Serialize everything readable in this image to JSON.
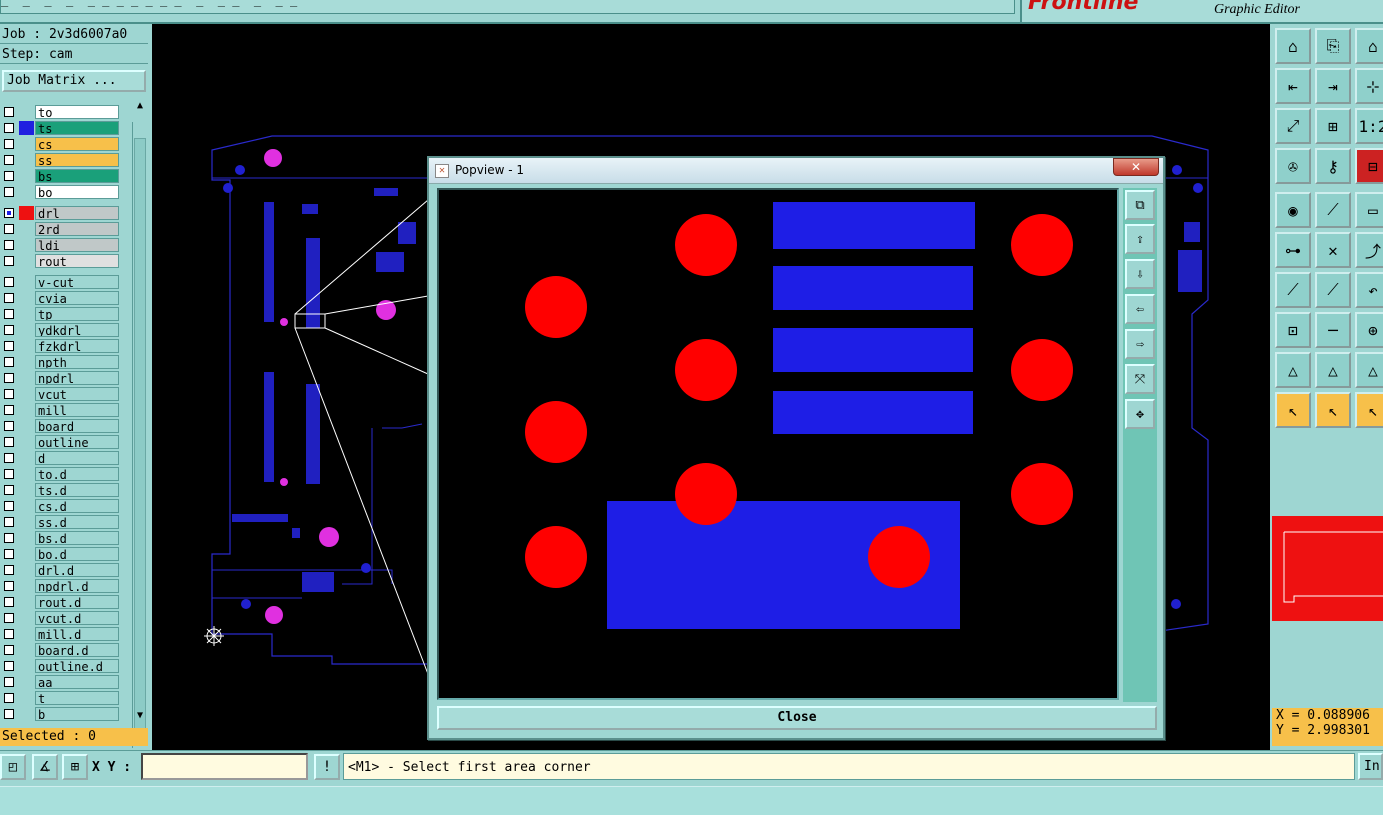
{
  "window": {
    "title_fragment": "_  _  _  _  _ _ _ _ _ _ _  _  _ _  _  _ _",
    "brand": "Frontline",
    "subtitle": "Graphic Editor"
  },
  "job": {
    "job_label": "Job : 2v3d6007a0",
    "step_label": "Step: cam",
    "matrix_button": "Job Matrix ..."
  },
  "layers": [
    {
      "name": "to",
      "swatch": "#ffffff",
      "bg": "#ffffff",
      "tag": "✎"
    },
    {
      "name": "ts",
      "swatch": "#2020e0",
      "bg": "#1aa07a",
      "tag": ""
    },
    {
      "name": "cs",
      "swatch": "#ffffff",
      "bg": "#f7c04a",
      "tag": "✎"
    },
    {
      "name": "ss",
      "swatch": "#ffffff",
      "bg": "#f7c04a",
      "tag": ""
    },
    {
      "name": "bs",
      "swatch": "#ffffff",
      "bg": "#1aa07a",
      "tag": ""
    },
    {
      "name": "bo",
      "swatch": "#ffffff",
      "bg": "#ffffff",
      "tag": ""
    },
    {
      "name": "drl",
      "swatch": "#ee1111",
      "bg": "#c0c8c8",
      "tag": "▦"
    },
    {
      "name": "2rd",
      "swatch": "#ffffff",
      "bg": "#c0c8c8",
      "tag": ""
    },
    {
      "name": "ldi",
      "swatch": "#ffffff",
      "bg": "#c0c8c8",
      "tag": ""
    },
    {
      "name": "rout",
      "swatch": "#ffffff",
      "bg": "#e0e0e0",
      "tag": ""
    },
    {
      "name": "v-cut",
      "swatch": "#ffffff",
      "bg": "#9ed6d2",
      "tag": ""
    },
    {
      "name": "cvia",
      "swatch": "#ffffff",
      "bg": "#9ed6d2",
      "tag": ""
    },
    {
      "name": "tp",
      "swatch": "#ffffff",
      "bg": "#9ed6d2",
      "tag": ""
    },
    {
      "name": "ydkdrl",
      "swatch": "#ffffff",
      "bg": "#9ed6d2",
      "tag": ""
    },
    {
      "name": "fzkdrl",
      "swatch": "#ffffff",
      "bg": "#9ed6d2",
      "tag": ""
    },
    {
      "name": "npth",
      "swatch": "#ffffff",
      "bg": "#9ed6d2",
      "tag": ""
    },
    {
      "name": "npdrl",
      "swatch": "#ffffff",
      "bg": "#9ed6d2",
      "tag": ""
    },
    {
      "name": "vcut",
      "swatch": "#ffffff",
      "bg": "#9ed6d2",
      "tag": ""
    },
    {
      "name": "mill",
      "swatch": "#ffffff",
      "bg": "#9ed6d2",
      "tag": "✎"
    },
    {
      "name": "board",
      "swatch": "#ffffff",
      "bg": "#9ed6d2",
      "tag": "✎"
    },
    {
      "name": "outline",
      "swatch": "#ffffff",
      "bg": "#9ed6d2",
      "tag": ""
    },
    {
      "name": "d",
      "swatch": "#ffffff",
      "bg": "#9ed6d2",
      "tag": ""
    },
    {
      "name": "to.d",
      "swatch": "#ffffff",
      "bg": "#9ed6d2",
      "tag": "✎"
    },
    {
      "name": "ts.d",
      "swatch": "#ffffff",
      "bg": "#9ed6d2",
      "tag": ""
    },
    {
      "name": "cs.d",
      "swatch": "#ffffff",
      "bg": "#9ed6d2",
      "tag": "✎"
    },
    {
      "name": "ss.d",
      "swatch": "#ffffff",
      "bg": "#9ed6d2",
      "tag": ""
    },
    {
      "name": "bs.d",
      "swatch": "#ffffff",
      "bg": "#9ed6d2",
      "tag": ""
    },
    {
      "name": "bo.d",
      "swatch": "#ffffff",
      "bg": "#9ed6d2",
      "tag": ""
    },
    {
      "name": "drl.d",
      "swatch": "#ffffff",
      "bg": "#9ed6d2",
      "tag": ""
    },
    {
      "name": "npdrl.d",
      "swatch": "#ffffff",
      "bg": "#9ed6d2",
      "tag": ""
    },
    {
      "name": "rout.d",
      "swatch": "#ffffff",
      "bg": "#9ed6d2",
      "tag": ""
    },
    {
      "name": "vcut.d",
      "swatch": "#ffffff",
      "bg": "#9ed6d2",
      "tag": ""
    },
    {
      "name": "mill.d",
      "swatch": "#ffffff",
      "bg": "#9ed6d2",
      "tag": "✎"
    },
    {
      "name": "board.d",
      "swatch": "#ffffff",
      "bg": "#9ed6d2",
      "tag": "✎"
    },
    {
      "name": "outline.d",
      "swatch": "#ffffff",
      "bg": "#9ed6d2",
      "tag": ""
    },
    {
      "name": "aa",
      "swatch": "#ffffff",
      "bg": "#9ed6d2",
      "tag": ""
    },
    {
      "name": "t",
      "swatch": "#ffffff",
      "bg": "#9ed6d2",
      "tag": ""
    },
    {
      "name": "b",
      "swatch": "#ffffff",
      "bg": "#9ed6d2",
      "tag": ""
    }
  ],
  "selected_label": "Selected : 0",
  "coords": {
    "x_label": "X = 0.088906",
    "y_label": "Y = 2.998301"
  },
  "bottom": {
    "xy_label": "X Y :",
    "xy_value": "",
    "prompt": "<M1> - Select first area corner",
    "in_button": "In"
  },
  "popview": {
    "title": "Popview - 1",
    "close_button": "Close",
    "close_x": "✕"
  },
  "colors": {
    "pad_blue": "#1e1ee6",
    "drill_red": "#ff0000",
    "via_magenta": "#e030e0",
    "outline_blue": "#2a2acc",
    "panel_teal": "#9ed6d2",
    "highlight_orange": "#f7c04a"
  },
  "right_tools": [
    "gui-home-icon",
    "gui-step-icon",
    "gui-home2-icon",
    "zoom-back-icon",
    "zoom-fwd-icon",
    "pan-icon",
    "zoom-fit-icon",
    "zoom-area-icon",
    "ratio-1-2-icon",
    "measure-tool-icon",
    "key-icon",
    "netlist-icon",
    "snap-icon",
    "line-red-icon",
    "ruler-icon",
    "connect-icon",
    "cross-icon",
    "route-icon",
    "arc-red-icon",
    "line-blue-icon",
    "undo-arc-icon",
    "pad-icon",
    "minus-icon",
    "move-icon",
    "triangle-icon",
    "triangle-up-icon",
    "triangle-r-icon",
    "pointer-icon",
    "pointer-box-icon",
    "pointer-box2-icon"
  ]
}
